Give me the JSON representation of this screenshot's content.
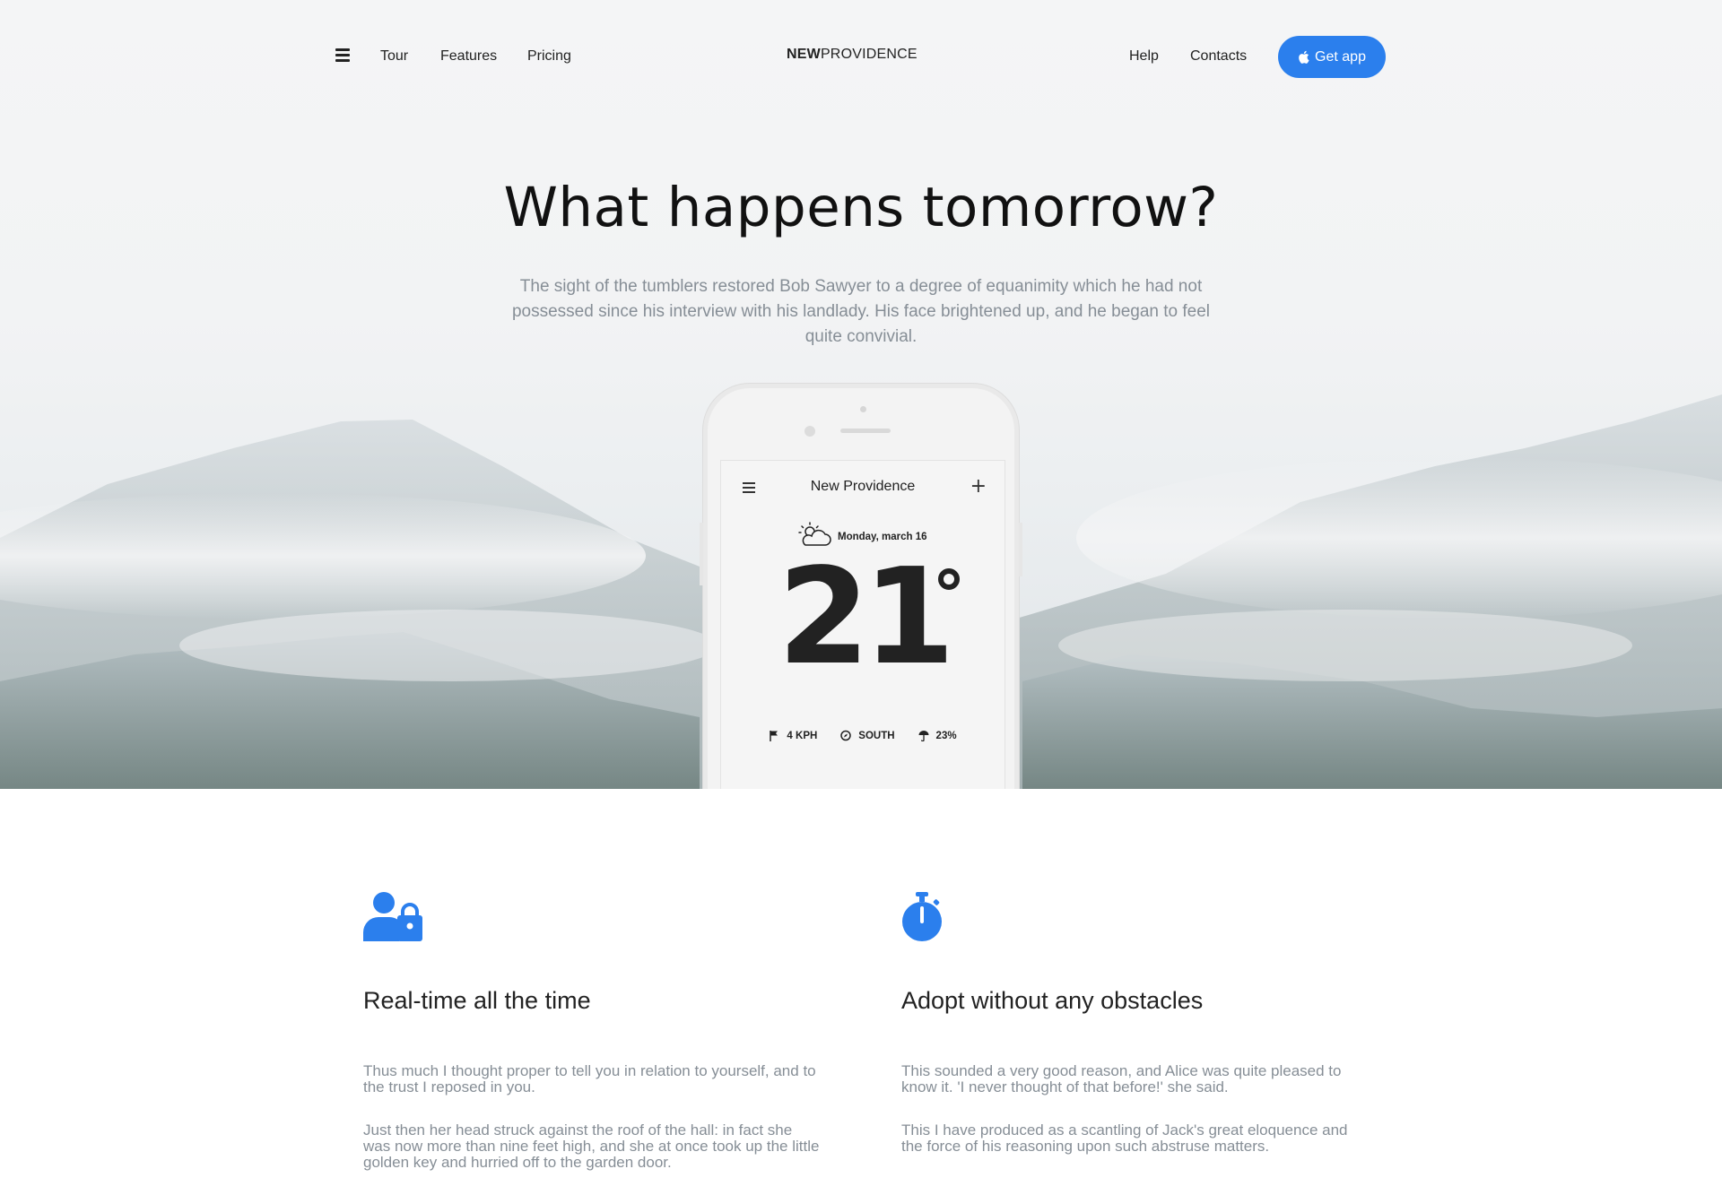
{
  "nav": {
    "tour": "Tour",
    "features": "Features",
    "pricing": "Pricing",
    "brand_bold": "NEW",
    "brand_rest": "PROVIDENCE",
    "help": "Help",
    "contacts": "Contacts",
    "get_app": "Get app"
  },
  "hero": {
    "headline": "What happens tomorrow?",
    "lead": "The sight of the tumblers restored Bob Sawyer to a degree of equanimity which he had not possessed since his interview with his landlady. His face brightened up, and he began to feel quite convivial."
  },
  "phone": {
    "title": "New Providence",
    "date": "Monday, march 16",
    "temperature": "21",
    "wind": "4 KPH",
    "direction": "SOUTH",
    "humidity": "23%"
  },
  "features": [
    {
      "icon": "user-lock-icon",
      "title": "Real-time all the time",
      "p1": "Thus much I thought proper to tell you in relation to yourself, and to the trust I reposed in you.",
      "p2": "Just then her head struck against the roof of the hall: in fact she was now more than nine feet high, and she at once took up the little golden key and hurried off to the garden door."
    },
    {
      "icon": "stopwatch-icon",
      "title": "Adopt without any obstacles",
      "p1": "This sounded a very good reason, and Alice was quite pleased to know it. 'I never thought of that before!' she said.",
      "p2": "This I have produced as a scantling of Jack's great eloquence and the force of his reasoning upon such abstruse matters."
    }
  ],
  "colors": {
    "accent": "#2b7fed",
    "muted_text": "#868e96"
  }
}
